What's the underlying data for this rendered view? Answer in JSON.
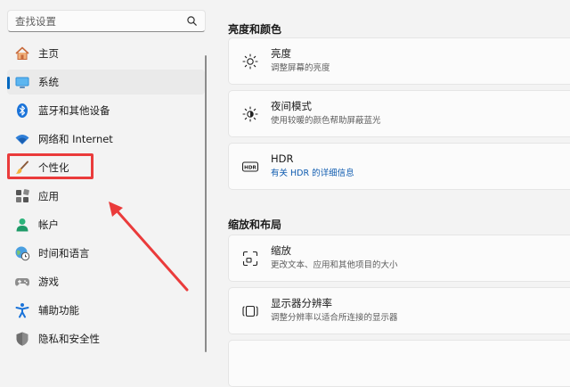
{
  "search": {
    "placeholder": "查找设置"
  },
  "sidebar": {
    "items": [
      {
        "label": "主页",
        "icon": "home-icon"
      },
      {
        "label": "系统",
        "icon": "monitor-icon",
        "selected": true
      },
      {
        "label": "蓝牙和其他设备",
        "icon": "bluetooth-icon"
      },
      {
        "label": "网络和 Internet",
        "icon": "wifi-icon"
      },
      {
        "label": "个性化",
        "icon": "paintbrush-icon",
        "highlighted": true
      },
      {
        "label": "应用",
        "icon": "apps-icon"
      },
      {
        "label": "帐户",
        "icon": "account-icon"
      },
      {
        "label": "时间和语言",
        "icon": "globe-clock-icon"
      },
      {
        "label": "游戏",
        "icon": "gamepad-icon"
      },
      {
        "label": "辅助功能",
        "icon": "accessibility-icon"
      },
      {
        "label": "隐私和安全性",
        "icon": "shield-icon"
      }
    ]
  },
  "main": {
    "section1": {
      "title": "亮度和颜色",
      "cards": [
        {
          "title": "亮度",
          "subtitle": "调整屏幕的亮度",
          "icon": "brightness-icon"
        },
        {
          "title": "夜间模式",
          "subtitle": "使用较暖的颜色帮助屏蔽蓝光",
          "icon": "night-light-icon"
        },
        {
          "title": "HDR",
          "subtitle": "有关 HDR 的详细信息",
          "icon": "hdr-icon",
          "subtitle_is_link": true
        }
      ]
    },
    "section2": {
      "title": "缩放和布局",
      "cards": [
        {
          "title": "缩放",
          "subtitle": "更改文本、应用和其他项目的大小",
          "icon": "scale-icon"
        },
        {
          "title": "显示器分辨率",
          "subtitle": "调整分辨率以适合所连接的显示器",
          "icon": "resolution-icon"
        }
      ]
    }
  },
  "colors": {
    "accent": "#0067c0",
    "annotation": "#ea3b3b",
    "link": "#0f5cb0"
  }
}
